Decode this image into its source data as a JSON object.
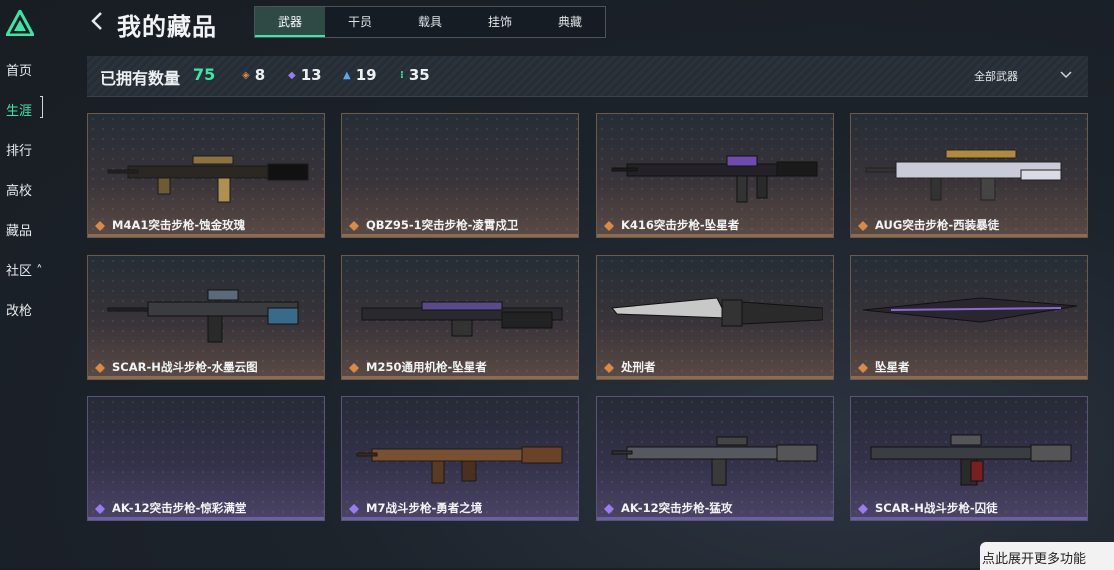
{
  "sidebar": {
    "items": [
      {
        "label": "首页"
      },
      {
        "label": "生涯"
      },
      {
        "label": "排行"
      },
      {
        "label": "高校"
      },
      {
        "label": "藏品"
      },
      {
        "label": "社区 ˄"
      },
      {
        "label": "改枪"
      }
    ],
    "active": "生涯"
  },
  "header": {
    "title": "我的藏品",
    "tabs": [
      {
        "label": "武器"
      },
      {
        "label": "干员"
      },
      {
        "label": "载具"
      },
      {
        "label": "挂饰"
      },
      {
        "label": "典藏"
      }
    ],
    "active_tab": "武器"
  },
  "summary": {
    "owned_label": "已拥有数量",
    "owned_total": "75",
    "rarities": [
      {
        "glyph": "◈",
        "color": "#d98a4a",
        "count": "8"
      },
      {
        "glyph": "◆",
        "color": "#9b7cf0",
        "count": "13"
      },
      {
        "glyph": "▲",
        "color": "#5aa8f0",
        "count": "19"
      },
      {
        "glyph": "⁝",
        "color": "#3ee6a4",
        "count": "35"
      }
    ],
    "filter_label": "全部武器"
  },
  "items": [
    {
      "name": "M4A1突击步枪-蚀金玫瑰",
      "rarity": "orange",
      "art": "rifle-gold"
    },
    {
      "name": "QBZ95-1突击步枪-凌霄戍卫",
      "rarity": "orange",
      "art": "none"
    },
    {
      "name": "K416突击步枪-坠星者",
      "rarity": "orange",
      "art": "rifle-purple"
    },
    {
      "name": "AUG突击步枪-西装暴徒",
      "rarity": "orange",
      "art": "bullpup-white"
    },
    {
      "name": "SCAR-H战斗步枪-水墨云图",
      "rarity": "orange",
      "art": "rifle-ink"
    },
    {
      "name": "M250通用机枪-坠星者",
      "rarity": "orange",
      "art": "mg-purple"
    },
    {
      "name": "处刑者",
      "rarity": "orange",
      "art": "knife-serrated"
    },
    {
      "name": "坠星者",
      "rarity": "orange",
      "art": "knife-purple"
    },
    {
      "name": "AK-12突击步枪-惊彩满堂",
      "rarity": "purple",
      "art": "none"
    },
    {
      "name": "M7战斗步枪-勇者之境",
      "rarity": "purple",
      "art": "rifle-bronze"
    },
    {
      "name": "AK-12突击步枪-猛攻",
      "rarity": "purple",
      "art": "rifle-grey"
    },
    {
      "name": "SCAR-H战斗步枪-囚徒",
      "rarity": "purple",
      "art": "rifle-dark"
    }
  ],
  "colors": {
    "accent": "#3ee6a4",
    "orange_rarity": "#d98a4a",
    "purple_rarity": "#9b7cf0"
  },
  "footer": {
    "more_label": "点此展开更多功能"
  }
}
